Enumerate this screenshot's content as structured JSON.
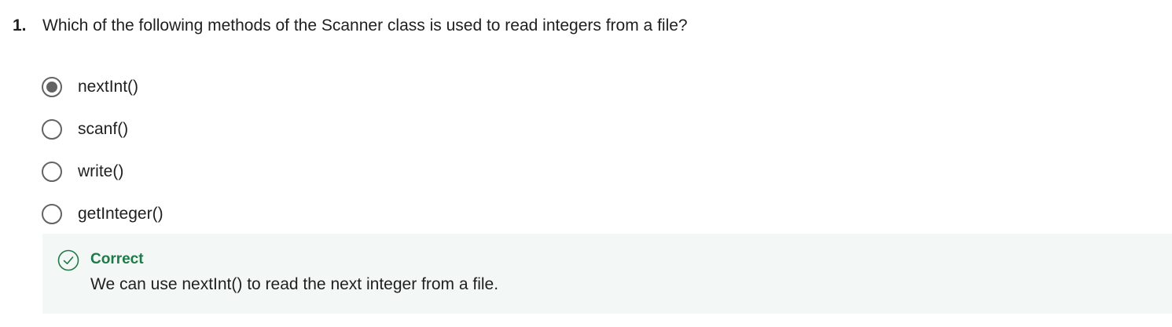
{
  "question": {
    "number": "1.",
    "text": "Which of the following methods of the Scanner class is used to read integers from a file?"
  },
  "options": [
    {
      "label": "nextInt()",
      "selected": true
    },
    {
      "label": "scanf()",
      "selected": false
    },
    {
      "label": "write()",
      "selected": false
    },
    {
      "label": "getInteger()",
      "selected": false
    }
  ],
  "feedback": {
    "icon": "check-circle-icon",
    "status": "Correct",
    "message": "We can use nextInt() to read the next integer from a file.",
    "status_color": "#1f7a4a",
    "background_color": "#f3f8f6"
  }
}
